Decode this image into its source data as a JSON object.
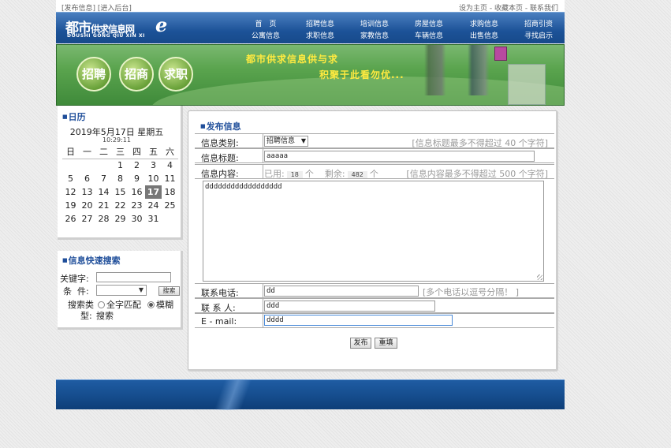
{
  "topbar": {
    "post_info": "[发布信息]",
    "admin": "[进入后台]",
    "set_home": "设为主页",
    "favorite": "收藏本页",
    "contact": "联系我们",
    "sep": " - "
  },
  "logo": {
    "main": "都市",
    "sub": "供求信息网",
    "e": "e",
    "pinyin": "DOUSHI GONG QIU XIN XI"
  },
  "nav": [
    [
      "首　页",
      "招聘信息",
      "培训信息",
      "房屋信息",
      "求购信息",
      "招商引资"
    ],
    [
      "公寓信息",
      "求职信息",
      "家教信息",
      "车辆信息",
      "出售信息",
      "寻找启示"
    ]
  ],
  "banner": {
    "slogan1": "都市供求信息供与求",
    "slogan2": "积聚于此看勿优...",
    "buttons": [
      "招聘",
      "招商",
      "求职"
    ]
  },
  "calendar": {
    "title": "日历",
    "date": "2019年5月17日 星期五",
    "time": "10:29:11",
    "weekdays": [
      "日",
      "一",
      "二",
      "三",
      "四",
      "五",
      "六"
    ],
    "weeks": [
      [
        "",
        "",
        "",
        "1",
        "2",
        "3",
        "4"
      ],
      [
        "5",
        "6",
        "7",
        "8",
        "9",
        "10",
        "11"
      ],
      [
        "12",
        "13",
        "14",
        "15",
        "16",
        "17",
        "18"
      ],
      [
        "19",
        "20",
        "21",
        "22",
        "23",
        "24",
        "25"
      ],
      [
        "26",
        "27",
        "28",
        "29",
        "30",
        "31",
        ""
      ]
    ],
    "today": "17"
  },
  "search": {
    "title": "信息快速搜索",
    "keyword_label": "关键字:",
    "keyword_value": "",
    "condition_label": "条  件:",
    "condition_value": "",
    "search_button": "搜索",
    "type_label_1": "搜索类",
    "type_label_2": "型:",
    "option_exact": "全字匹配",
    "option_fuzzy": "模糊",
    "option_fuzzy_2": "搜索"
  },
  "form": {
    "title": "发布信息",
    "category_label": "信息类别:",
    "category_value": "招聘信息",
    "category_hint": "[信息标题最多不得超过 40 个字符]",
    "title_label": "信息标题:",
    "title_value": "aaaaa",
    "content_label": "信息内容:",
    "used_label": "已用:",
    "used_count": "18",
    "unit": "个",
    "remain_label": "剩余:",
    "remain_count": "482",
    "content_hint": "[信息内容最多不得超过 500 个字符]",
    "content_value": "dddddddddddddddddd",
    "phone_label": "联系电话:",
    "phone_value": "dd",
    "phone_hint": "[多个电话以逗号分隔！ ]",
    "contact_label": "联 系 人:",
    "contact_value": "ddd",
    "email_label": "E - mail:",
    "email_value": "dddd",
    "submit_button": "发布",
    "reset_button": "重填"
  }
}
